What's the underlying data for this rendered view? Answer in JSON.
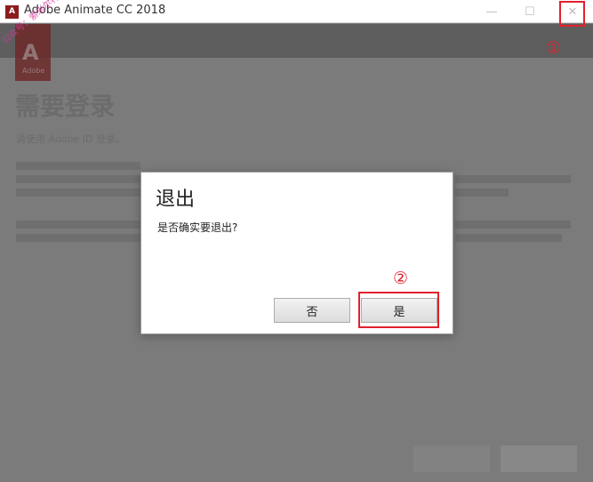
{
  "window": {
    "app_icon_glyph": "A",
    "title": "Adobe Animate CC 2018",
    "minimize_glyph": "—",
    "maximize_glyph": "☐",
    "close_glyph": "✕"
  },
  "annotations": {
    "marker_1": "①",
    "marker_2": "②",
    "highlight_color": "#e2202d"
  },
  "background": {
    "watermark": "公众号：索米尔特",
    "logo_letter": "A",
    "logo_word": "Adobe",
    "heading": "需要登录",
    "line_1": "请使用 Adobe ID 登录。"
  },
  "dialog": {
    "title": "退出",
    "message": "是否确实要退出?",
    "no_label": "否",
    "yes_label": "是"
  }
}
